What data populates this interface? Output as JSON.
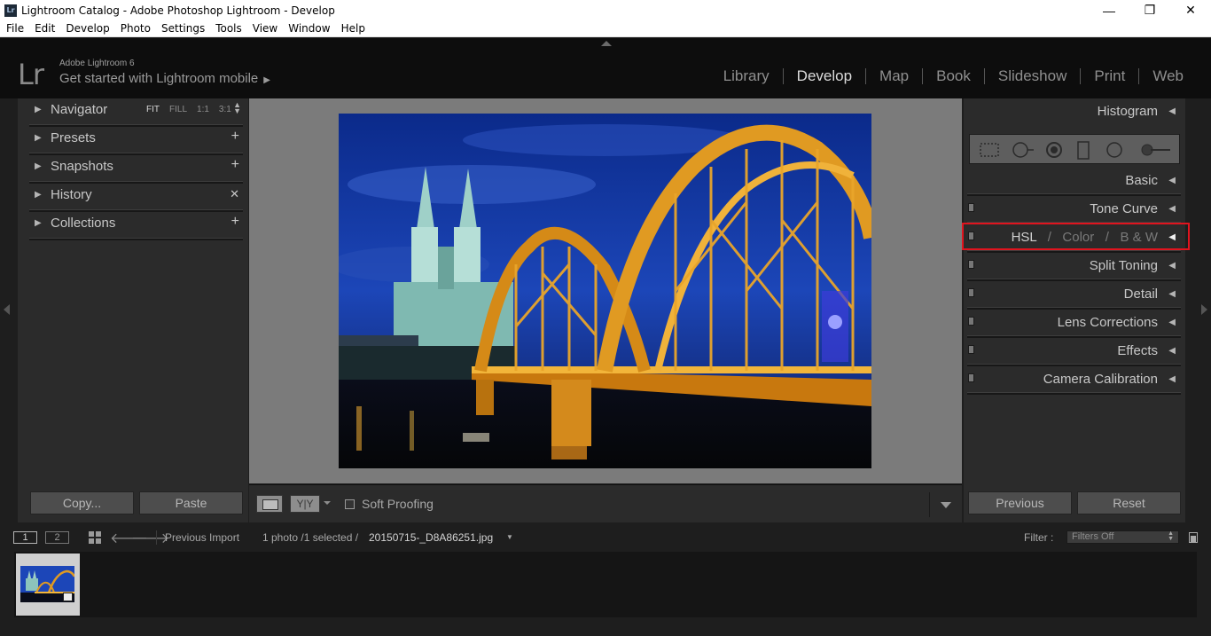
{
  "window": {
    "title": "Lightroom Catalog - Adobe Photoshop Lightroom - Develop",
    "app_icon": "Lr",
    "minimize": "—",
    "restore": "❐",
    "close": "✕"
  },
  "menu": [
    "File",
    "Edit",
    "Develop",
    "Photo",
    "Settings",
    "Tools",
    "View",
    "Window",
    "Help"
  ],
  "identity": {
    "logo": "Lr",
    "version": "Adobe Lightroom 6",
    "mobile_prompt": "Get started with Lightroom mobile",
    "mobile_arrow": "▶"
  },
  "modules": {
    "active": "Develop",
    "items": [
      "Library",
      "Develop",
      "Map",
      "Book",
      "Slideshow",
      "Print",
      "Web"
    ]
  },
  "left_panel": {
    "navigator": {
      "label": "Navigator",
      "zoom": [
        "FIT",
        "FILL",
        "1:1",
        "3:1"
      ],
      "updown": "▲▼"
    },
    "presets": {
      "label": "Presets",
      "action": "+"
    },
    "snapshots": {
      "label": "Snapshots",
      "action": "+"
    },
    "history": {
      "label": "History",
      "action": "✕"
    },
    "collections": {
      "label": "Collections",
      "action": "+"
    },
    "triangle": "▶",
    "copy_button": "Copy...",
    "paste_button": "Paste"
  },
  "toolbar": {
    "compare_label": "Y|Y",
    "soft_proofing": "Soft Proofing"
  },
  "right_panel": {
    "histogram": "Histogram",
    "basic": "Basic",
    "tone_curve": "Tone Curve",
    "hsl": {
      "hsl": "HSL",
      "sep": "/",
      "color": "Color",
      "bw": "B & W"
    },
    "split_toning": "Split Toning",
    "detail": "Detail",
    "lens_corrections": "Lens Corrections",
    "effects": "Effects",
    "camera_calibration": "Camera Calibration",
    "triangle": "◀",
    "previous_button": "Previous",
    "reset_button": "Reset"
  },
  "filmstrip_bar": {
    "screen1": "1",
    "screen2": "2",
    "back": "🡐",
    "forward": "🡒",
    "source": "Previous Import",
    "count": "1 photo /1 selected /",
    "filename": "20150715-_D8A86251.jpg",
    "filename_caret": "▼",
    "filter_label": "Filter :",
    "filter_value": "Filters Off"
  },
  "colors": {
    "accent_highlight": "#e0141e",
    "panel_bg": "#2b2b2b",
    "workspace_bg": "#7b7b7b"
  }
}
